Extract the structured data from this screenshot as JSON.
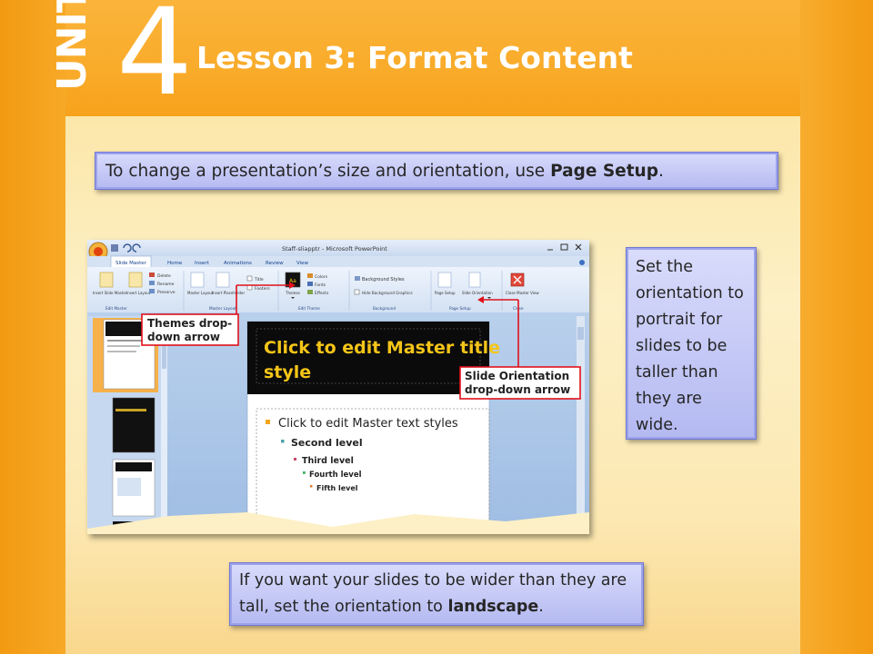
{
  "header": {
    "unit_label": "UNIT",
    "unit_number": "4",
    "lesson_title": "Lesson 3: Format Content"
  },
  "callouts": {
    "top": {
      "text_before": "To change a presentation’s size and orientation, use ",
      "bold": "Page Setup",
      "text_after": "."
    },
    "right": {
      "text": "Set the orientation to portrait for slides to be taller than they are wide."
    },
    "bottom": {
      "text_before": "If you want your slides to be wider than they are tall, set the orientation to ",
      "bold": "landscape",
      "text_after": "."
    }
  },
  "screenshot": {
    "window_title": "Staff-sliapptr - Microsoft PowerPoint",
    "tabs": [
      "Slide Master",
      "Home",
      "Insert",
      "Animations",
      "Review",
      "View"
    ],
    "ribbon_buttons": [
      "Insert Slide Master",
      "Insert Layout",
      "Delete",
      "Rename",
      "Preserve",
      "Master Layout",
      "Insert Placeholder",
      "Title",
      "Footers",
      "Themes",
      "Colors",
      "Fonts",
      "Effects",
      "Background Styles",
      "Hide Background Graphics",
      "Page Setup",
      "Slide Orientation",
      "Close Master View"
    ],
    "ribbon_groups": [
      "Edit Master",
      "Master Layout",
      "Edit Theme",
      "Background",
      "Page Setup",
      "Close"
    ],
    "annotations": {
      "themes": "Themes drop-down arrow",
      "orientation": "Slide Orientation drop-down arrow"
    },
    "slide_title": "Click to edit Master title style",
    "text_levels": [
      "Click to edit Master text styles",
      "Second level",
      "Third level",
      "Fourth level",
      "Fifth level"
    ],
    "colors": {
      "ribbon": "#dbe8f7",
      "tab_active": "#ffffff",
      "title_bg": "#0b0b0b",
      "title_text": "#f5c518",
      "annotation_red": "#e0101a",
      "workspace": "#a9c4e6"
    }
  }
}
